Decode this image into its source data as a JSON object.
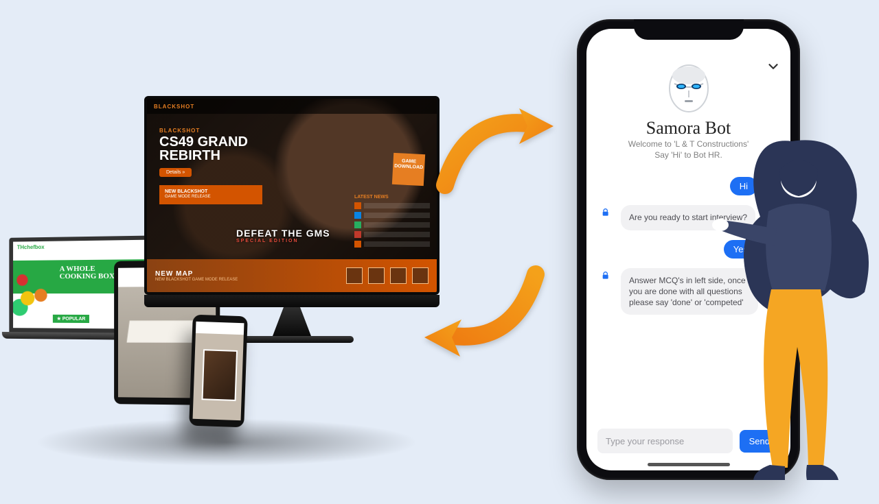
{
  "monitor": {
    "logo": "BLACKSHOT",
    "franchise": "BLACKSHOT",
    "hero_title_l1": "CS49 GRAND",
    "hero_title_l2": "REBIRTH",
    "cta": "Details »",
    "download_l1": "GAME",
    "download_l2": "DOWNLOAD",
    "band_title": "NEW BLACKSHOT",
    "band_sub": "GAME MODE RELEASE",
    "right_header": "LATEST NEWS",
    "defeat": "DEFEAT THE GMS",
    "defeat_sub": "SPECIAL EDITION",
    "newmap": "NEW MAP",
    "newmap_sub": "NEW BLACKSHOT GAME MODE RELEASE"
  },
  "laptop": {
    "brand": "THchefbox",
    "headline_l1": "A WHOLE",
    "headline_l2": "COOKING BOX",
    "popular": "★ POPULAR"
  },
  "bot": {
    "title": "Samora Bot",
    "welcome_l1": "Welcome to 'L & T Constructions'",
    "welcome_l2": "Say 'Hi' to Bot HR.",
    "msg_hi": "Hi",
    "msg_q1": "Are you ready to start interview?",
    "msg_yes": "Yes",
    "msg_q2": "Answer MCQ's in left side, once you are done with all questions please say 'done' or 'competed'",
    "placeholder": "Type your response",
    "send": "Send"
  }
}
